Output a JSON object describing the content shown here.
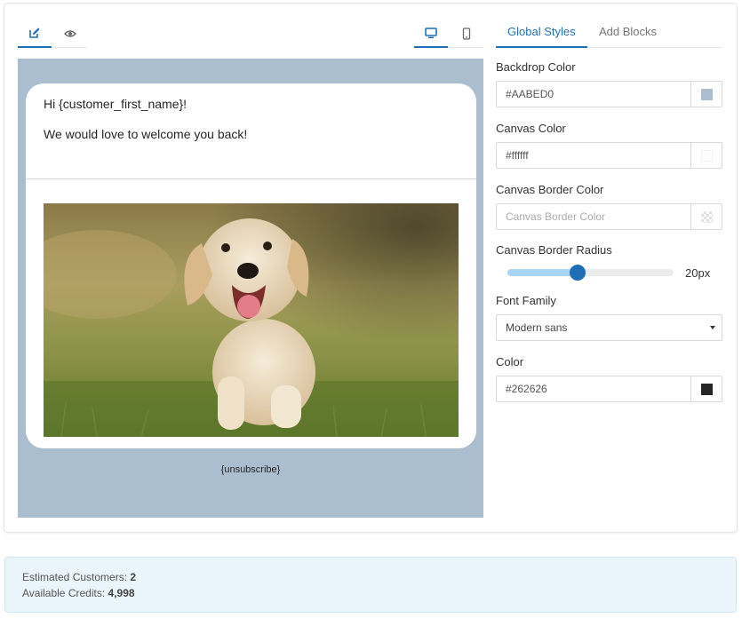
{
  "toolbar": {
    "edit_icon": "edit-icon",
    "preview_icon": "eye-icon",
    "desktop_icon": "monitor-icon",
    "mobile_icon": "smartphone-icon"
  },
  "email": {
    "greeting": "Hi {customer_first_name}!",
    "body": "We would love to welcome you back!",
    "image_subject": "golden retriever puppy running on grass",
    "unsubscribe": "{unsubscribe}"
  },
  "tabs": [
    {
      "label": "Global Styles",
      "active": true
    },
    {
      "label": "Add Blocks",
      "active": false
    }
  ],
  "styles": {
    "backdrop": {
      "label": "Backdrop Color",
      "value": "#AABED0",
      "swatch": "#AABED0"
    },
    "canvas": {
      "label": "Canvas Color",
      "value": "#ffffff",
      "swatch": "#ffffff"
    },
    "canvas_border": {
      "label": "Canvas Border Color",
      "placeholder": "Canvas Border Color",
      "value": ""
    },
    "border_radius": {
      "label": "Canvas Border Radius",
      "value_text": "20px",
      "fraction": 0.42
    },
    "font_family": {
      "label": "Font Family",
      "value": "Modern sans"
    },
    "color": {
      "label": "Color",
      "value": "#262626",
      "swatch": "#262626"
    }
  },
  "colors": {
    "accent": "#1e6fb8",
    "slider_fill": "#a9d4f4"
  },
  "info": {
    "customers_label": "Estimated Customers:",
    "customers_value": "2",
    "credits_label": "Available Credits:",
    "credits_value": "4,998"
  }
}
